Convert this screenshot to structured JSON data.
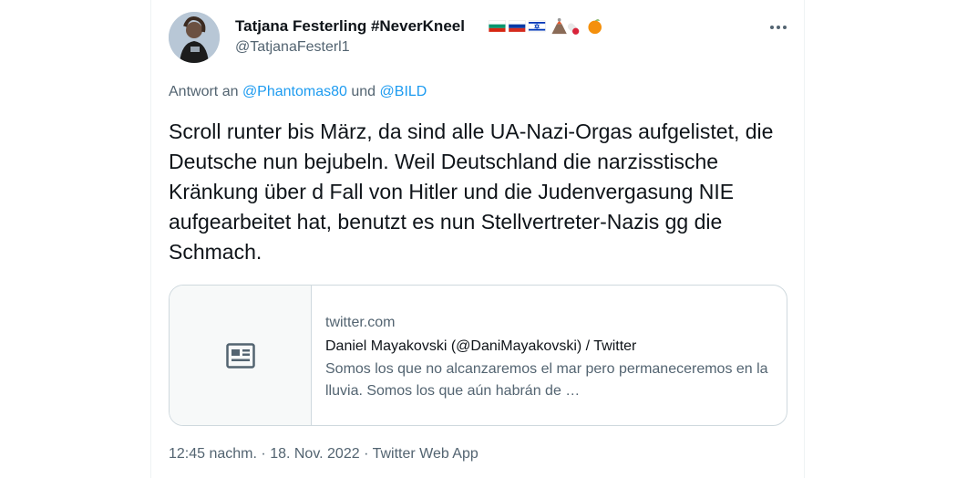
{
  "author": {
    "display_name": "Tatjana Festerling #NeverKneel",
    "handle": "@TatjanaFesterl1",
    "badges": [
      "flag-bulgaria",
      "flag-russia",
      "flag-israel",
      "volcano-emoji",
      "pill-emoji",
      "tangerine-emoji"
    ]
  },
  "reply": {
    "prefix": "Antwort an",
    "mention1": "@Phantomas80",
    "joiner": "und",
    "mention2": "@BILD"
  },
  "tweet_text": "Scroll runter bis März, da sind alle UA-Nazi-Orgas aufgelistet, die Deutsche nun bejubeln. Weil Deutschland die narzisstische Kränkung über d Fall von Hitler und die Judenvergasung NIE aufgearbeitet hat, benutzt es nun Stellvertreter-Nazis gg die Schmach.",
  "card": {
    "domain": "twitter.com",
    "title": "Daniel Mayakovski (@DaniMayakovski) / Twitter",
    "description": "Somos los que no alcanzaremos el mar pero permaneceremos en la lluvia. Somos los que aún habrán de …",
    "icon": "news-article-icon"
  },
  "meta": {
    "time": "12:45 nachm.",
    "sep1": "·",
    "date": "18. Nov. 2022",
    "sep2": "·",
    "source": "Twitter Web App"
  },
  "more_icon": "more-dots-icon",
  "colors": {
    "link": "#1d9bf0",
    "secondary_text": "#536471",
    "primary_text": "#0f1419",
    "border": "#cfd9de"
  }
}
